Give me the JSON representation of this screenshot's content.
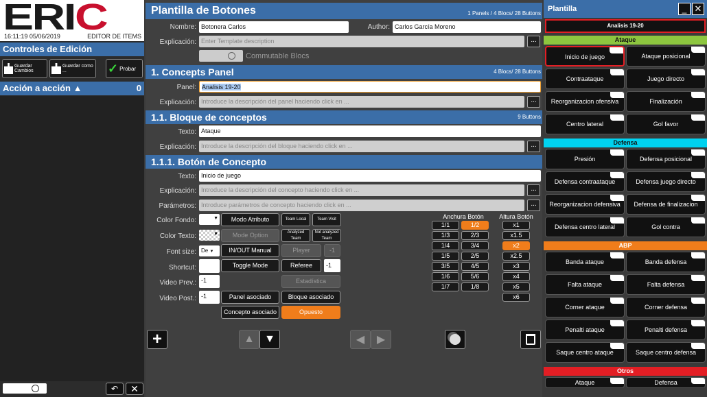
{
  "left": {
    "time": "16:11:19 05/06/2019",
    "editor": "EDITOR DE ITEMS",
    "logo": "ERIC",
    "controls_title": "Controles de Edición",
    "save": "Guardar Cambios",
    "save_as": "Guardar como ...",
    "test": "Probar",
    "action_title": "Acción a acción",
    "action_count": "0"
  },
  "mid": {
    "title": "Plantilla de Botones",
    "summary": "1 Panels / 4 Blocs/ 28 Buttons",
    "name_label": "Nombre:",
    "name_value": "Botonera Carlos",
    "author_label": "Author:",
    "author_value": "Carlos García Moreno",
    "expl_label": "Explicación:",
    "expl_placeholder": "Enter Template description",
    "commutable": "Commutable Blocs",
    "panel_title": "1. Concepts Panel",
    "panel_summary": "4 Blocs/ 28 Buttons",
    "panel_label": "Panel:",
    "panel_value": "Analisis 19-20",
    "panel_expl": "Introduce la descripción del panel haciendo click en ...",
    "bloque_title": "1.1. Bloque de conceptos",
    "bloque_summary": "9 Buttons",
    "texto_label": "Texto:",
    "bloque_text": "Ataque",
    "bloque_expl": "Introduce la descripción del bloque haciendo click en ...",
    "boton_title": "1.1.1. Botón de Concepto",
    "boton_text": "Inicio de juego",
    "boton_expl": "Introduce la descripción del concepto haciendo click en ...",
    "param_label": "Parámetros:",
    "param_placeholder": "Introduce parámetros de concepto haciendo click en ...",
    "dots": "...",
    "color_fondo": "Color Fondo:",
    "color_texto": "Color Texto:",
    "font_size": "Font size:",
    "font_value": "De",
    "shortcut": "Shortcut:",
    "video_prev": "Video Prev.:",
    "video_prev_val": "-1",
    "video_post": "Video Post.:",
    "video_post_val": "-1",
    "modo_atributo": "Modo Atributo",
    "mode_option": "Mode Option",
    "inout": "IN/OUT Manual",
    "toggle": "Toggle Mode",
    "panel_asoc": "Panel asociado",
    "concepto_asoc": "Concepto asociado",
    "team_local": "Team Local",
    "team_visit": "Team Visit",
    "analyzed": "Analyzed Team",
    "not_analyzed": "Not analyzed Team",
    "player": "Player",
    "player_val": "-1",
    "referee": "Referee",
    "referee_val": "-1",
    "estadistica": "Estadística",
    "bloque_asoc": "Bloque asociado",
    "opuesto": "Opuesto",
    "anchura_title": "Anchura Botón",
    "anchura": [
      "1/1",
      "1/2",
      "1/3",
      "2/3",
      "1/4",
      "3/4",
      "1/5",
      "2/5",
      "3/5",
      "4/5",
      "1/6",
      "5/6",
      "1/7",
      "1/8"
    ],
    "anchura_selected": "1/2",
    "altura_title": "Altura Botón",
    "altura": [
      "x1",
      "x1.5",
      "x2",
      "x2.5",
      "x3",
      "x4",
      "x5",
      "x6"
    ],
    "altura_selected": "x2"
  },
  "right": {
    "title": "Plantilla",
    "panel_name": "Analisis 19-20",
    "categories": [
      {
        "name": "Ataque",
        "color": "#8dc63f",
        "buttons": [
          "Inicio de juego",
          "Ataque posicional",
          "Contraataque",
          "Juego directo",
          "Reorganizacion ofensiva",
          "Finalización",
          "Centro lateral",
          "Gol favor"
        ]
      },
      {
        "name": "Defensa",
        "color": "#00d2f0",
        "buttons": [
          "Presión",
          "Defensa posicional",
          "Defensa contraataque",
          "Defensa juego directo",
          "Reorganizacion defensiva",
          "Defensa de finalizacion",
          "Defensa centro lateral",
          "Gol contra"
        ]
      },
      {
        "name": "ABP",
        "color": "#f07d1b",
        "buttons": [
          "Banda ataque",
          "Banda defensa",
          "Falta ataque",
          "Falta defensa",
          "Corner ataque",
          "Corner defensa",
          "Penalti ataque",
          "Penalti defensa",
          "Saque centro ataque",
          "Saque centro defensa"
        ]
      },
      {
        "name": "Otros",
        "color": "#e31e24",
        "buttons": [
          "Ataque",
          "Defensa"
        ]
      }
    ]
  }
}
